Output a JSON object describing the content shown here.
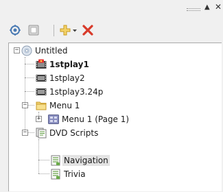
{
  "panel": {
    "collapse_glyph": "▲",
    "close_glyph": "✕"
  },
  "toolbar": {
    "buttons": [
      {
        "name": "target-icon"
      },
      {
        "name": "properties-icon"
      },
      {
        "name": "add-dropdown-icon"
      },
      {
        "name": "delete-icon"
      }
    ]
  },
  "tree": {
    "nodes": [
      {
        "label": "Untitled",
        "icon": "disc-icon",
        "bold": false,
        "expanded": true
      },
      {
        "label": "1stplay1",
        "icon": "movie-first-play-icon",
        "bold": true
      },
      {
        "label": "1stplay2",
        "icon": "movie-clip-icon",
        "bold": false
      },
      {
        "label": "1stplay3.24p",
        "icon": "movie-clip-icon",
        "bold": false
      },
      {
        "label": "Menu 1",
        "icon": "folder-icon",
        "bold": false,
        "expanded": true
      },
      {
        "label": "Menu 1 (Page 1)",
        "icon": "menu-page-icon",
        "bold": false,
        "expanded": false
      },
      {
        "label": "DVD Scripts",
        "icon": "scripts-folder-icon",
        "bold": false,
        "expanded": true
      },
      {
        "label": "Navigation",
        "icon": "script-icon",
        "bold": false,
        "selected": true
      },
      {
        "label": "Trivia",
        "icon": "script-icon",
        "bold": false
      }
    ]
  },
  "colors": {
    "selection": "#e3e3e3",
    "delete_red": "#d83a2a",
    "folder_yellow": "#f1d372"
  }
}
